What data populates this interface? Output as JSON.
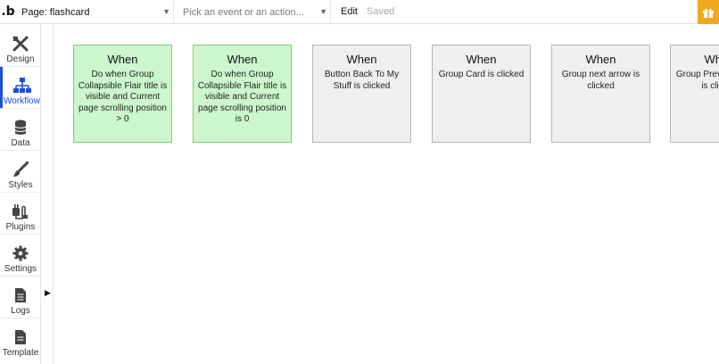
{
  "topbar": {
    "logo": ".b",
    "page_label": "Page: flashcard",
    "event_placeholder": "Pick an event or an action...",
    "edit_label": "Edit",
    "saved_label": "Saved"
  },
  "sidebar": {
    "items": [
      {
        "label": "Design",
        "icon": "design-icon"
      },
      {
        "label": "Workflow",
        "icon": "workflow-icon",
        "active": true
      },
      {
        "label": "Data",
        "icon": "database-icon"
      },
      {
        "label": "Styles",
        "icon": "brush-icon"
      },
      {
        "label": "Plugins",
        "icon": "plug-icon"
      },
      {
        "label": "Settings",
        "icon": "gear-icon"
      },
      {
        "label": "Logs",
        "icon": "document-icon"
      },
      {
        "label": "Template",
        "icon": "template-icon"
      }
    ]
  },
  "workflows": [
    {
      "title": "When",
      "description": "Do when Group Collapsible Flair title is visible and Current page scrolling position > 0",
      "state": "active"
    },
    {
      "title": "When",
      "description": "Do when Group Collapsible Flair title is visible and Current page scrolling position is 0",
      "state": "active"
    },
    {
      "title": "When",
      "description": "Button Back To My Stuff is clicked",
      "state": "default"
    },
    {
      "title": "When",
      "description": "Group Card is clicked",
      "state": "default"
    },
    {
      "title": "When",
      "description": "Group next arrow is clicked",
      "state": "default"
    },
    {
      "title": "When",
      "description": "Group Previous arrow is clicked",
      "state": "default"
    }
  ],
  "colors": {
    "accent": "#1b4fd8",
    "active_card": "#ccf7cc",
    "default_card": "#efefef",
    "gift": "#f2a81d"
  }
}
